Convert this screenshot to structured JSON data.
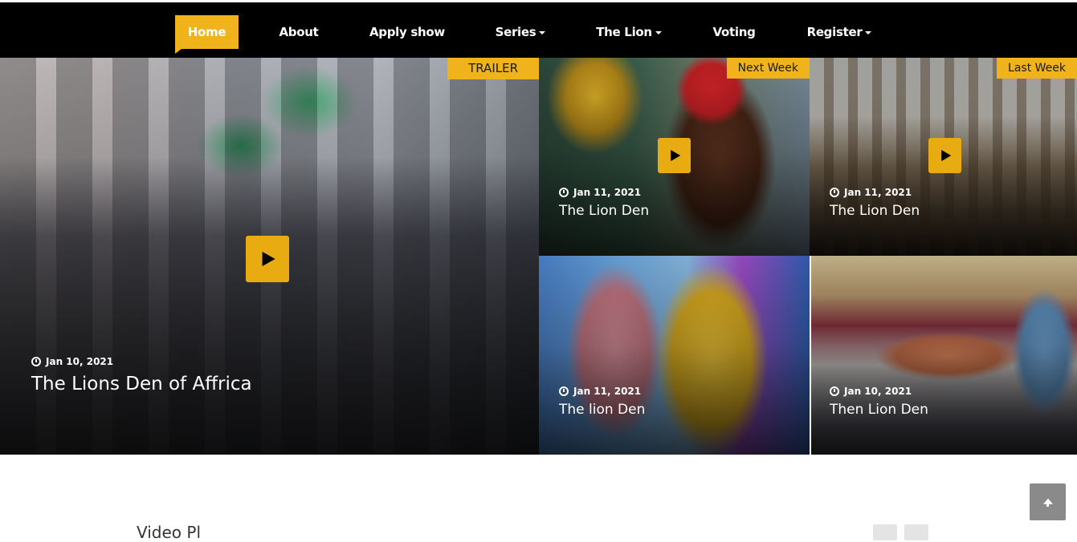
{
  "nav": {
    "items": [
      {
        "label": "Home",
        "active": true
      },
      {
        "label": "About"
      },
      {
        "label": "Apply show"
      },
      {
        "label": "Series",
        "dropdown": true
      },
      {
        "label": "The Lion",
        "dropdown": true
      },
      {
        "label": "Voting"
      },
      {
        "label": "Register",
        "dropdown": true
      }
    ]
  },
  "featured": {
    "badge": "TRAILER",
    "date": "Jan 10, 2021",
    "title": "The Lions Den of Affrica"
  },
  "posts": [
    {
      "badge": "Next Week",
      "date": "Jan 11, 2021",
      "title": "The Lion Den"
    },
    {
      "badge": "Last Week",
      "date": "Jan 11, 2021",
      "title": "The Lion Den"
    },
    {
      "date": "Jan 11, 2021",
      "title": "The lion Den"
    },
    {
      "date": "Jan 10, 2021",
      "title": "Then Lion Den"
    }
  ],
  "section": {
    "title": "Video Pl"
  },
  "colors": {
    "accent": "#f0b31b",
    "navbar": "#000000"
  },
  "icons": {
    "play": "play-icon",
    "clock": "clock-icon",
    "to_top": "arrow-up-icon",
    "dropdown": "caret-down-icon"
  }
}
